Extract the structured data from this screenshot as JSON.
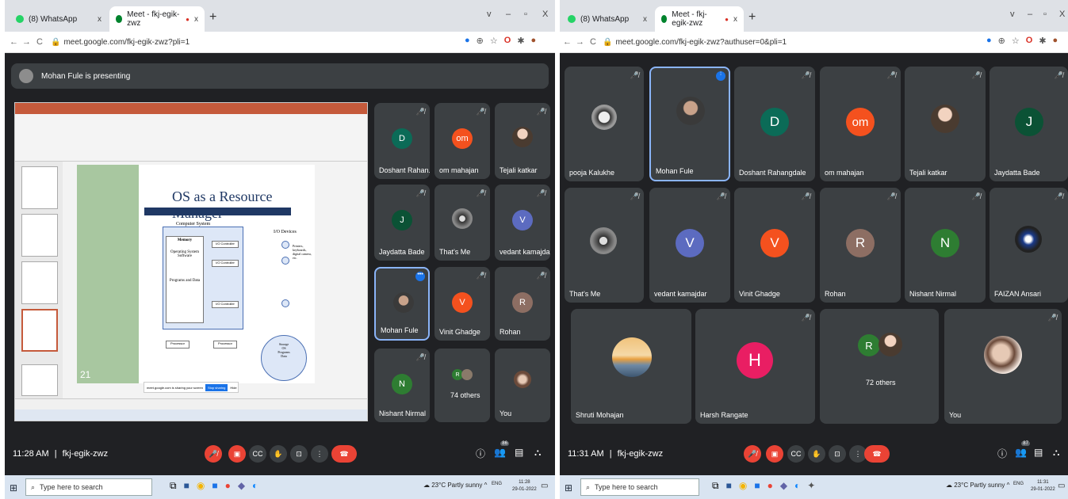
{
  "left": {
    "tabs": [
      {
        "label": "(8) WhatsApp",
        "close": "x"
      },
      {
        "label": "Meet - fkj-egik-zwz",
        "close": "x"
      }
    ],
    "new_tab": "+",
    "window_controls": [
      "v",
      "–",
      "▫",
      "X"
    ],
    "url": "meet.google.com/fkj-egik-zwz?pli=1",
    "banner": "Mohan Fule is presenting",
    "slide": {
      "title": "OS as a Resource Manager",
      "computer_system": "Computer System",
      "memory": "Memory",
      "memory_items": [
        "Operating System Software",
        "Programs and Data"
      ],
      "io_controller": "I/O Controller",
      "processor": "Processor",
      "io_devices": "I/O Devices",
      "io_device_items": "Printers, keyboards, digital camera, etc.",
      "storage_items": [
        "Storage",
        "OS",
        "Programs",
        "Data"
      ],
      "number": "21",
      "share_text": "meet.google.com is sharing your screen",
      "stop_sharing": "Stop sharing",
      "hide": "Hide"
    },
    "tiles": [
      {
        "name": "Doshant Rahan...",
        "initial": "D",
        "color": "#0b6b57"
      },
      {
        "name": "om mahajan",
        "initial": "om",
        "color": "#f4511e"
      },
      {
        "name": "Tejali katkar",
        "initial": "",
        "color": ""
      },
      {
        "name": "Jaydatta Bade",
        "initial": "J",
        "color": "#0b5235"
      },
      {
        "name": "That's Me",
        "initial": "",
        "color": ""
      },
      {
        "name": "vedant kamajdar",
        "initial": "V",
        "color": "#5c6bc0"
      },
      {
        "name": "Mohan Fule",
        "initial": "",
        "color": ""
      },
      {
        "name": "Vinit Ghadge",
        "initial": "V",
        "color": "#f4511e"
      },
      {
        "name": "Rohan",
        "initial": "R",
        "color": "#8d6e63"
      },
      {
        "name": "Nishant Nirmal",
        "initial": "N",
        "color": "#2e7d32"
      },
      {
        "name": "74 others",
        "initial": "R",
        "color": "#2e7d32"
      },
      {
        "name": "You",
        "initial": "",
        "color": ""
      }
    ],
    "time": "11:28 AM",
    "separator": "|",
    "code": "fkj-egik-zwz",
    "people_count": "86",
    "taskbar": {
      "search": "Type here to search",
      "weather": "23°C Partly sunny",
      "lang": "ENG",
      "clock_time": "11:28",
      "clock_date": "29-01-2022"
    }
  },
  "right": {
    "tabs": [
      {
        "label": "(8) WhatsApp",
        "close": "x"
      },
      {
        "label": "Meet - fkj-egik-zwz",
        "close": "x"
      }
    ],
    "new_tab": "+",
    "window_controls": [
      "v",
      "–",
      "▫",
      "X"
    ],
    "url": "meet.google.com/fkj-egik-zwz?authuser=0&pli=1",
    "tiles": [
      {
        "name": "pooja Kalukhe",
        "initial": "",
        "color": ""
      },
      {
        "name": "Mohan Fule",
        "initial": "",
        "color": ""
      },
      {
        "name": "Doshant Rahangdale",
        "initial": "D",
        "color": "#0b6b57"
      },
      {
        "name": "om mahajan",
        "initial": "om",
        "color": "#f4511e"
      },
      {
        "name": "Tejali katkar",
        "initial": "",
        "color": ""
      },
      {
        "name": "Jaydatta Bade",
        "initial": "J",
        "color": "#0b5235"
      },
      {
        "name": "That's Me",
        "initial": "",
        "color": ""
      },
      {
        "name": "vedant kamajdar",
        "initial": "V",
        "color": "#5c6bc0"
      },
      {
        "name": "Vinit Ghadge",
        "initial": "V",
        "color": "#f4511e"
      },
      {
        "name": "Rohan",
        "initial": "R",
        "color": "#8d6e63"
      },
      {
        "name": "Nishant Nirmal",
        "initial": "N",
        "color": "#2e7d32"
      },
      {
        "name": "FAIZAN Ansari",
        "initial": "",
        "color": ""
      },
      {
        "name": "Shruti Mohajan",
        "initial": "",
        "color": ""
      },
      {
        "name": "Harsh Rangate",
        "initial": "H",
        "color": "#e91e63"
      },
      {
        "name": "72 others",
        "initial": "R",
        "color": "#2e7d32"
      },
      {
        "name": "You",
        "initial": "",
        "color": ""
      }
    ],
    "time": "11:31 AM",
    "separator": "|",
    "code": "fkj-egik-zwz",
    "people_count": "87",
    "taskbar": {
      "search": "Type here to search",
      "weather": "23°C Partly sunny",
      "lang": "ENG",
      "clock_time": "11:31",
      "clock_date": "29-01-2022"
    }
  },
  "colors": {
    "meet_bg": "#202124",
    "tile_bg": "#3c4043",
    "red": "#ea4335",
    "active_border": "#8ab4f8"
  }
}
